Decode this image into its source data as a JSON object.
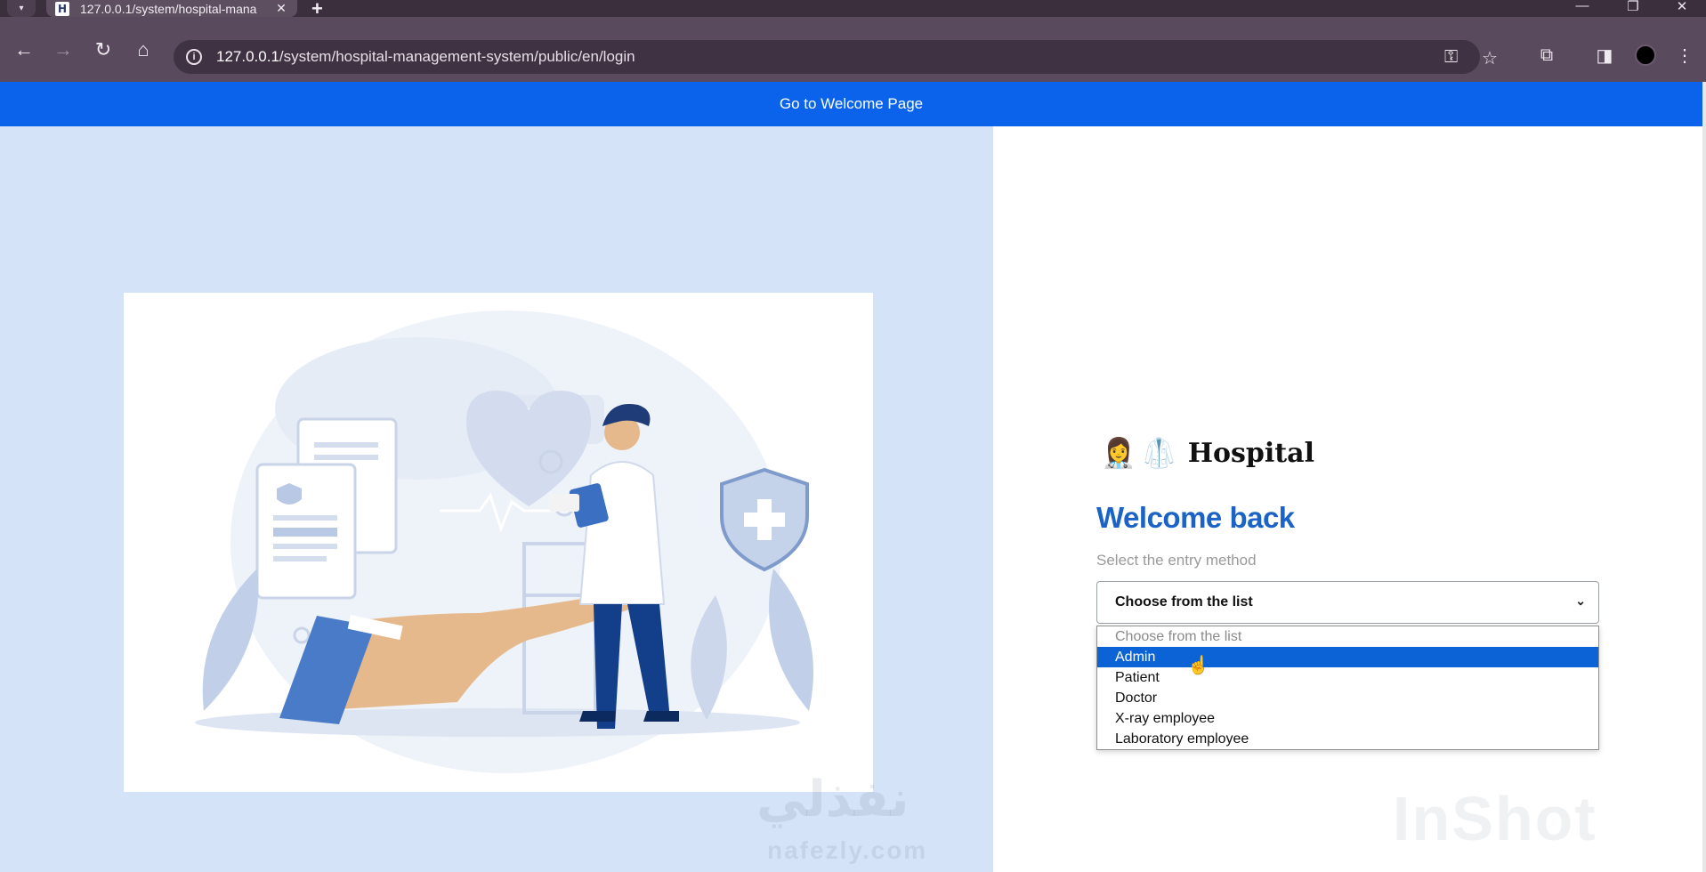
{
  "browser": {
    "tab_title": "127.0.0.1/system/hospital-mana",
    "favicon_letter": "H",
    "tab_close": "✕",
    "new_tab": "+",
    "url_host": "127.0.0.1",
    "url_path": "/system/hospital-management-system/public/en/login"
  },
  "page": {
    "topbar_link": "Go to Welcome Page",
    "brand": {
      "emoji_1": "👩‍⚕️",
      "emoji_2": "🥼",
      "name": "Hospital"
    },
    "welcome": "Welcome back",
    "subtitle": "Select the entry method",
    "select": {
      "value": "Choose from the list",
      "options": [
        "Choose from the list",
        "Admin",
        "Patient",
        "Doctor",
        "X-ray employee",
        "Laboratory employee"
      ],
      "highlighted_option": "Admin"
    }
  },
  "watermarks": {
    "arabic": "نفذلي",
    "site": "nafezly.com",
    "app": "InShot"
  },
  "colors": {
    "accent": "#0a63ea",
    "heading": "#1b63c7",
    "left_panel": "#d5e3f8"
  }
}
